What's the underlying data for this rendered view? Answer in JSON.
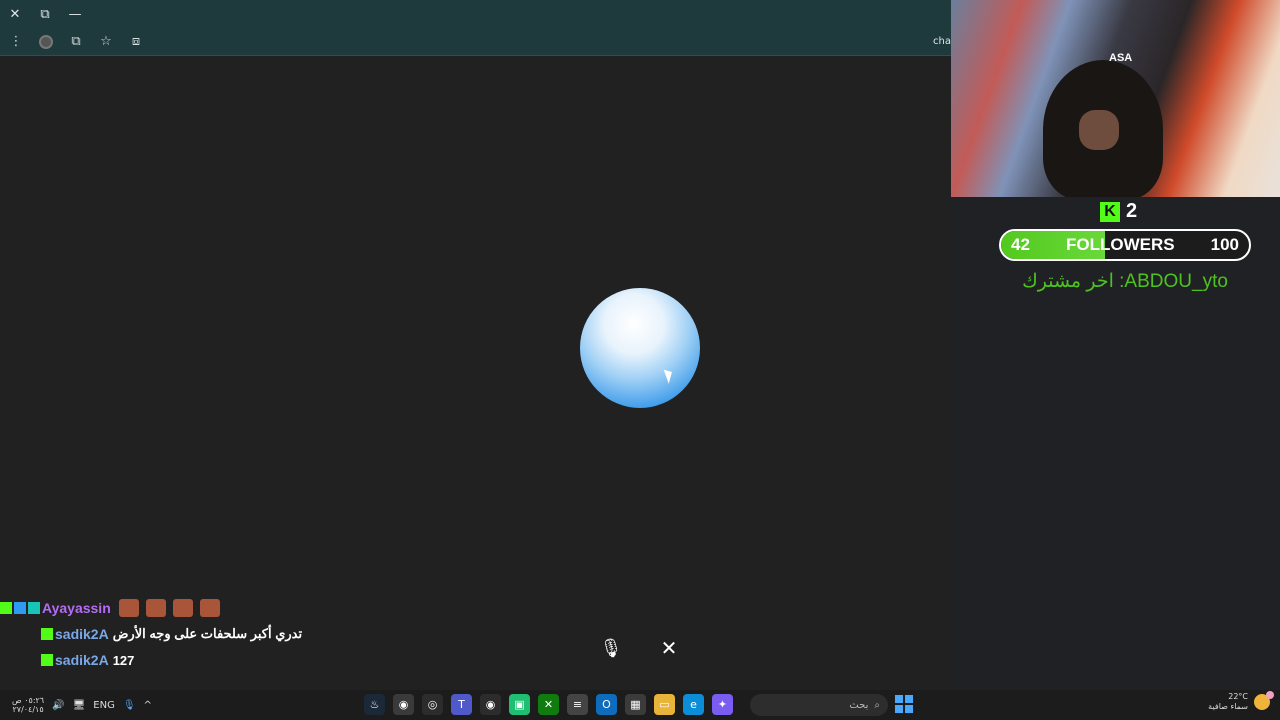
{
  "browser": {
    "titlebar": {
      "close": "✕",
      "restore": "⧉",
      "minimize": "—"
    },
    "toolbar": {
      "menu": "⋮",
      "extensions": "⧉",
      "star": "☆",
      "cast": "⧈",
      "trailing_text": "cha"
    }
  },
  "main": {
    "controls": {
      "mic": "🎙",
      "close": "✕"
    }
  },
  "stream": {
    "webcam_brand": "ASA",
    "kick_subs": "2",
    "followers": {
      "current": "42",
      "label": "FOLLOWERS",
      "goal": "100",
      "progress": 0.42
    },
    "last_subscriber": "اخر مشترك :ABDOU_yto"
  },
  "chat": {
    "messages": [
      {
        "user": "Ayayassin",
        "text": "",
        "emotes": 4
      },
      {
        "user": "sadik2A",
        "text": "تدري أكبر سلحفات على وجه الأرض"
      },
      {
        "user": "sadik2A",
        "text": "127"
      }
    ]
  },
  "taskbar": {
    "clock": {
      "time": "٠٥:٢٦ ص",
      "date": "٢٧/٠٤/١٥"
    },
    "language": "ENG",
    "search_placeholder": "بحث",
    "weather": {
      "temp": "22°C",
      "desc": "سماء صافية"
    },
    "colors": {
      "accent": "#4aa8ff",
      "kick": "#53fc18"
    }
  }
}
